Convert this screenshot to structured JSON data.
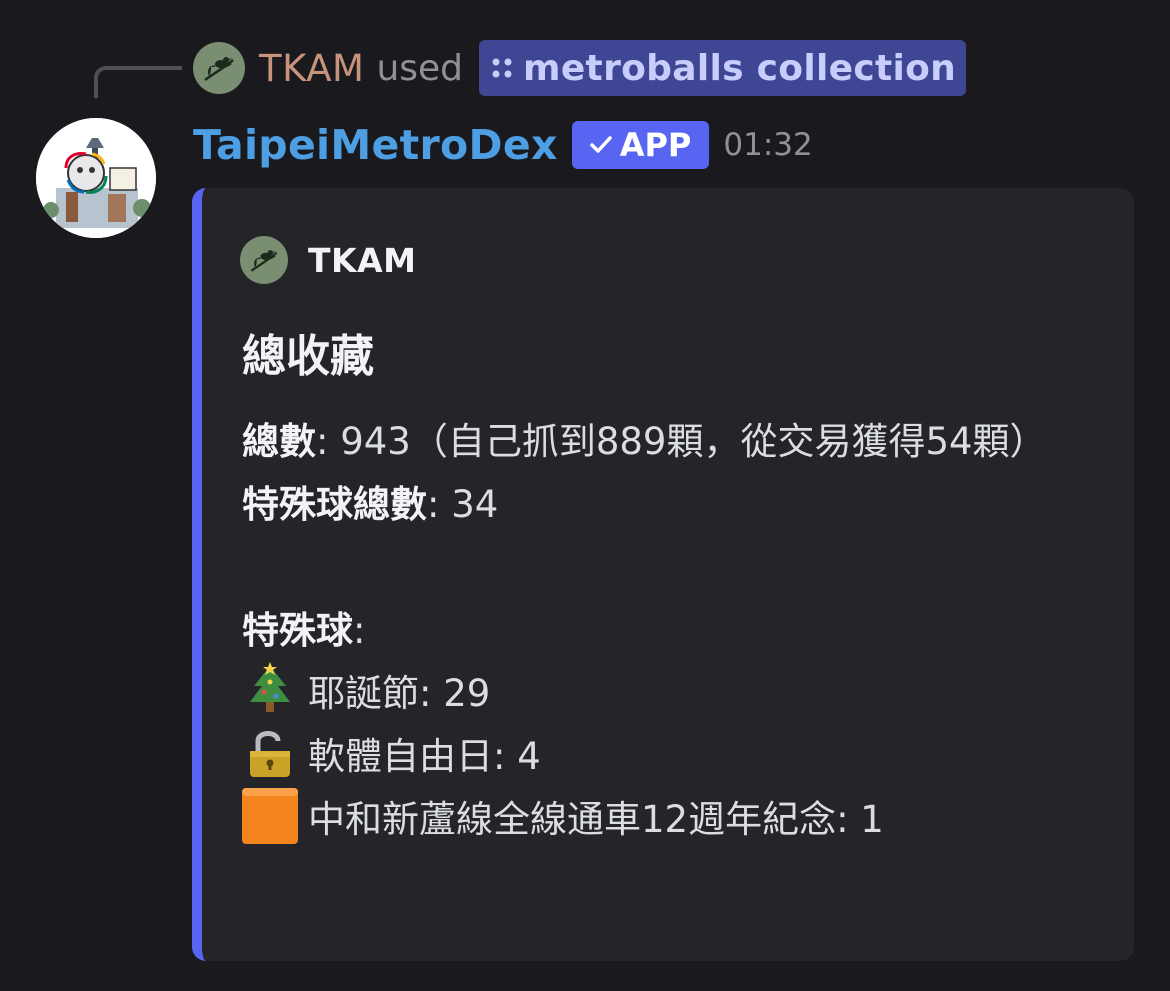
{
  "reply": {
    "user": "TKAM",
    "used_text": "used",
    "command_label": "metroballs collection",
    "avatar_icon": "bird-on-branch-icon",
    "avatar_color": "#7a8f72"
  },
  "message": {
    "bot_name": "TaipeiMetroDex",
    "badge_label": "APP",
    "badge_icon": "checkmark-icon",
    "timestamp": "01:32",
    "avatar_icon": "taipei-metro-illustration"
  },
  "embed": {
    "accent_color": "#5865f2",
    "author": "TKAM",
    "title": "總收藏",
    "total_label": "總數",
    "total_value": ": 943（自己抓到889顆，從交易獲得54顆）",
    "special_total_label": "特殊球總數",
    "special_total_value": ": 34",
    "special_label": "特殊球",
    "special_colon": ":",
    "special_items": [
      {
        "icon": "christmas-tree-icon",
        "text": "耶誕節: 29"
      },
      {
        "icon": "unlocked-padlock-icon",
        "text": "軟體自由日: 4"
      },
      {
        "icon": "orange-square-icon",
        "text": "中和新蘆線全線通車12週年紀念: 1"
      }
    ]
  }
}
